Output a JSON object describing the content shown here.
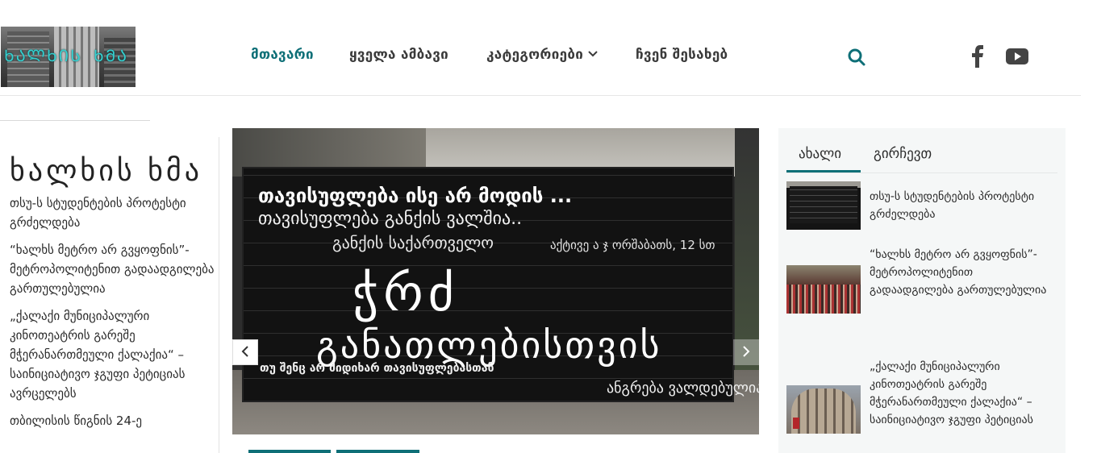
{
  "logo": {
    "text": "ᲮᲐᲚᲮᲘᲡ ᲮᲛᲐ"
  },
  "nav": {
    "items": [
      {
        "label": "მთავარი",
        "active": true
      },
      {
        "label": "ყველა ამბავი",
        "active": false
      },
      {
        "label": "კატეგორიები",
        "active": false,
        "has_dropdown": true
      },
      {
        "label": "ჩვენ შესახებ",
        "active": false
      }
    ]
  },
  "header_icons": [
    "search-icon",
    "facebook-icon",
    "youtube-icon"
  ],
  "left": {
    "title": "ხალხის ხმა",
    "items": [
      "თსუ-ს სტუდენტების პროტესტი გრძელდება",
      "“ხალხს მეტრო არ გვყოფნის”- მეტროპოლიტენით გადაადგილება გართულებულია",
      "„ქალაქი მუნიციპალური კინოთეატრის გარეშე მჭერანართმეული ქალაქია“ – საინიციატივო ჯგუფი პეტიციას ავრცელებს",
      "თბილისის წიგნის 24-ე"
    ]
  },
  "slider": {
    "board_lines": [
      "თავისუფლება ისე არ მოდის ...",
      "თავისუფლება განქის ვალშია..",
      "განქის საქართველო",
      "ჭრძ",
      "განათლებისთვის",
      "თუ შენც არ მიდიხარ თავისუფლებასთან",
      "აქტივე ა ჯ ორშაბათს, 12 სთ",
      "ანგრება ვალდებულია"
    ],
    "prev_label": "‹",
    "next_label": "›"
  },
  "right": {
    "tabs": [
      {
        "label": "ახალი",
        "active": true
      },
      {
        "label": "გირჩევთ",
        "active": false
      }
    ],
    "news": [
      {
        "title": "თსუ-ს სტუდენტების პროტესტი გრძელდება"
      },
      {
        "title": "“ხალხს მეტრო არ გვყოფნის”- მეტროპოლიტენით გადაადგილება გართულებულია"
      },
      {
        "title": "„ქალაქი მუნიციპალური კინოთეატრის გარეშე მჭერანართმეული ქალაქია“ – საინიციატივო ჯგუფი პეტიციას"
      }
    ]
  },
  "colors": {
    "accent": "#0e6f77",
    "text": "#2a2a2a",
    "panel_bg": "#f5f7f7"
  }
}
